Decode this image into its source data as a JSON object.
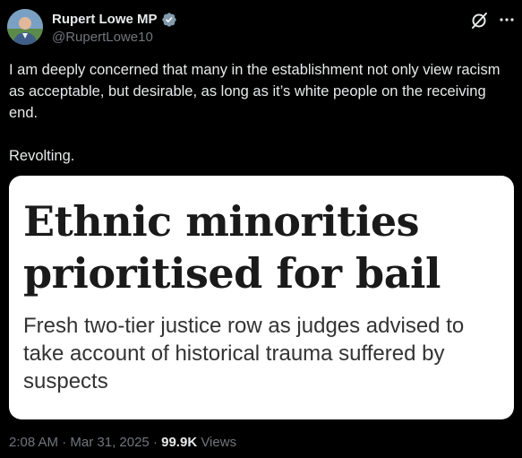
{
  "author": {
    "display_name": "Rupert Lowe MP",
    "handle": "@RupertLowe10",
    "verified": true,
    "avatar_icon": "profile-photo"
  },
  "tweet": {
    "paragraph1": "I am deeply concerned that many in the establishment not only view racism as acceptable, but desirable, as long as it’s white people on the receiving end.",
    "paragraph2": "Revolting."
  },
  "media": {
    "headline": "Ethnic minorities prioritised for bail",
    "subheadline": "Fresh two-tier justice row as judges advised to take account of historical trauma suffered by suspects"
  },
  "meta": {
    "time": "2:08 AM",
    "separator": " · ",
    "date": "Mar 31, 2025",
    "views_count": "99.9K",
    "views_label": " Views"
  },
  "icons": {
    "grok": "grok-icon",
    "more": "more-icon",
    "verified": "verified-badge-icon"
  },
  "colors": {
    "background": "#000000",
    "text": "#e7e9ea",
    "secondary_text": "#71767b",
    "verified_badge": "#829aab"
  }
}
